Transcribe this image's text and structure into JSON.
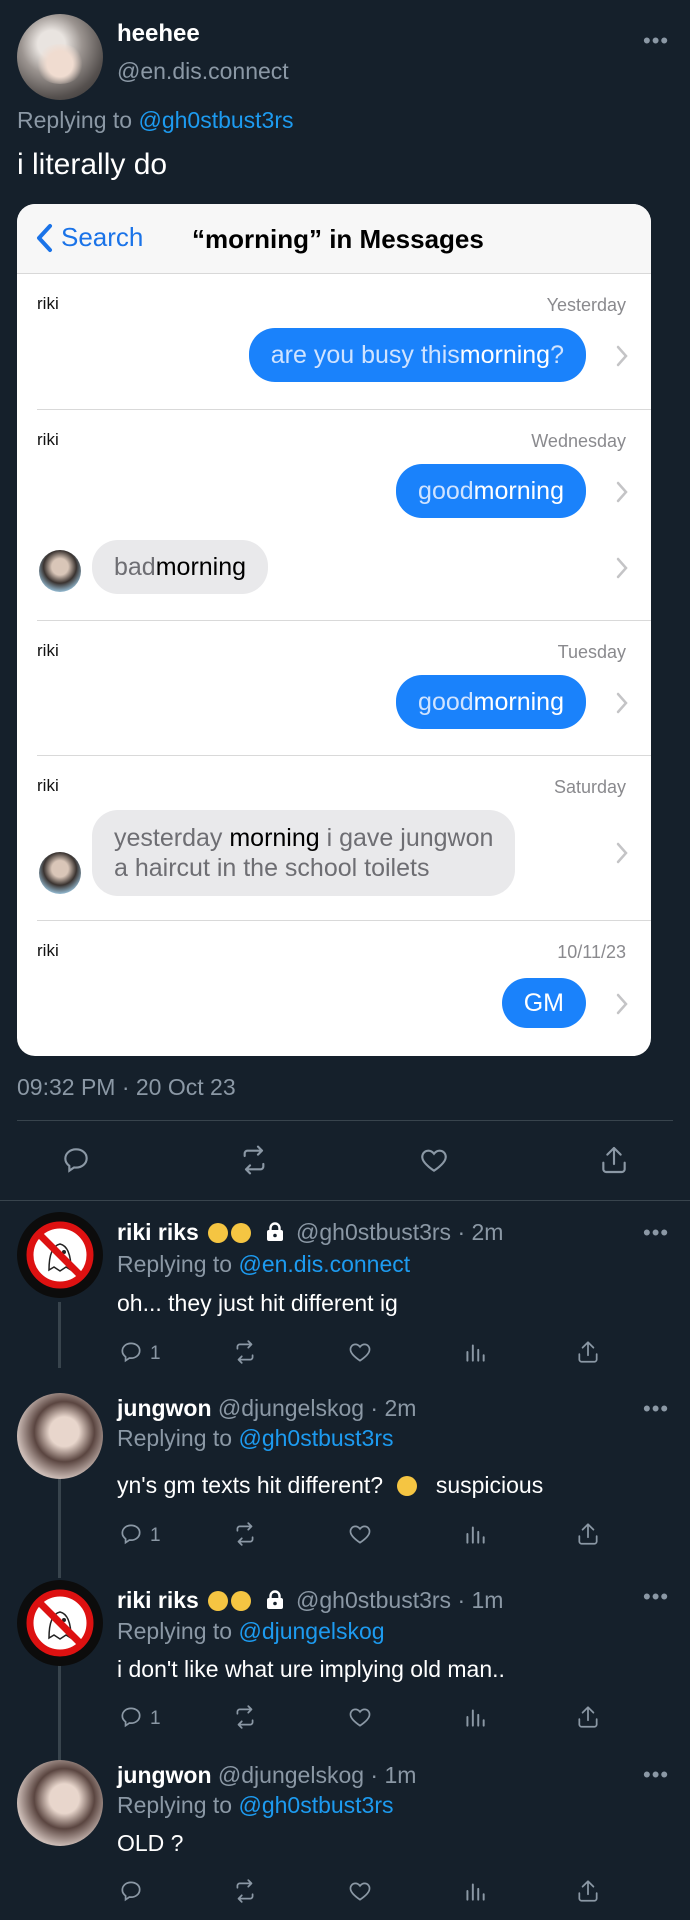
{
  "main_tweet": {
    "name": "heehee",
    "handle": "@en.dis.connect",
    "replying_prefix": "Replying to ",
    "replying_to": "@gh0stbust3rs",
    "text": "i literally do",
    "timestamp": "09:32 PM · 20 Oct 23",
    "more": "•••"
  },
  "screenshot": {
    "back_label": "Search",
    "title": "“morning” in Messages",
    "groups": [
      {
        "sender": "riki",
        "when": "Yesterday",
        "messages": [
          {
            "dir": "out",
            "before": "are you busy this ",
            "hl": "morning",
            "after": "?"
          }
        ]
      },
      {
        "sender": "riki",
        "when": "Wednesday",
        "messages": [
          {
            "dir": "out",
            "before": "good ",
            "hl": "morning",
            "after": ""
          },
          {
            "dir": "in",
            "before": "bad ",
            "hl": "morning",
            "after": ""
          }
        ]
      },
      {
        "sender": "riki",
        "when": "Tuesday",
        "messages": [
          {
            "dir": "out",
            "before": "good ",
            "hl": "morning",
            "after": ""
          }
        ]
      },
      {
        "sender": "riki",
        "when": "Saturday",
        "messages": [
          {
            "dir": "in",
            "before": "yesterday ",
            "hl": "morning",
            "after": " i gave jungwon",
            "line2": "a haircut in the school toilets"
          }
        ]
      },
      {
        "sender": "riki",
        "when": "10/11/23",
        "messages": [
          {
            "dir": "out",
            "before": "",
            "hl": "GM",
            "after": ""
          }
        ]
      }
    ]
  },
  "replies": [
    {
      "name": "riki riks",
      "handle": "@gh0stbust3rs",
      "time": "2m",
      "replying_to": "@en.dis.connect",
      "text": "oh... they just hit different ig",
      "reply_count": "1",
      "emoji": "😱😱",
      "locked": true
    },
    {
      "name": "jungwon",
      "handle": "@djungelskog",
      "time": "2m",
      "replying_to": "@gh0stbust3rs",
      "text": "yn's gm texts hit different?",
      "text_after": "suspicious",
      "reply_count": "1",
      "emoji_inline": "🤨"
    },
    {
      "name": "riki riks",
      "handle": "@gh0stbust3rs",
      "time": "1m",
      "replying_to": "@djungelskog",
      "text": "i don't like what ure implying old man..",
      "reply_count": "1",
      "emoji": "😱😱",
      "locked": true
    },
    {
      "name": "jungwon",
      "handle": "@djungelskog",
      "time": "1m",
      "replying_to": "@gh0stbust3rs",
      "text": "OLD ?",
      "reply_count": ""
    }
  ],
  "separator": " · ",
  "colors": {
    "background": "#15202b",
    "link": "#1d9bf0",
    "muted": "#8b98a5",
    "imessage_blue": "#1a82fb"
  }
}
